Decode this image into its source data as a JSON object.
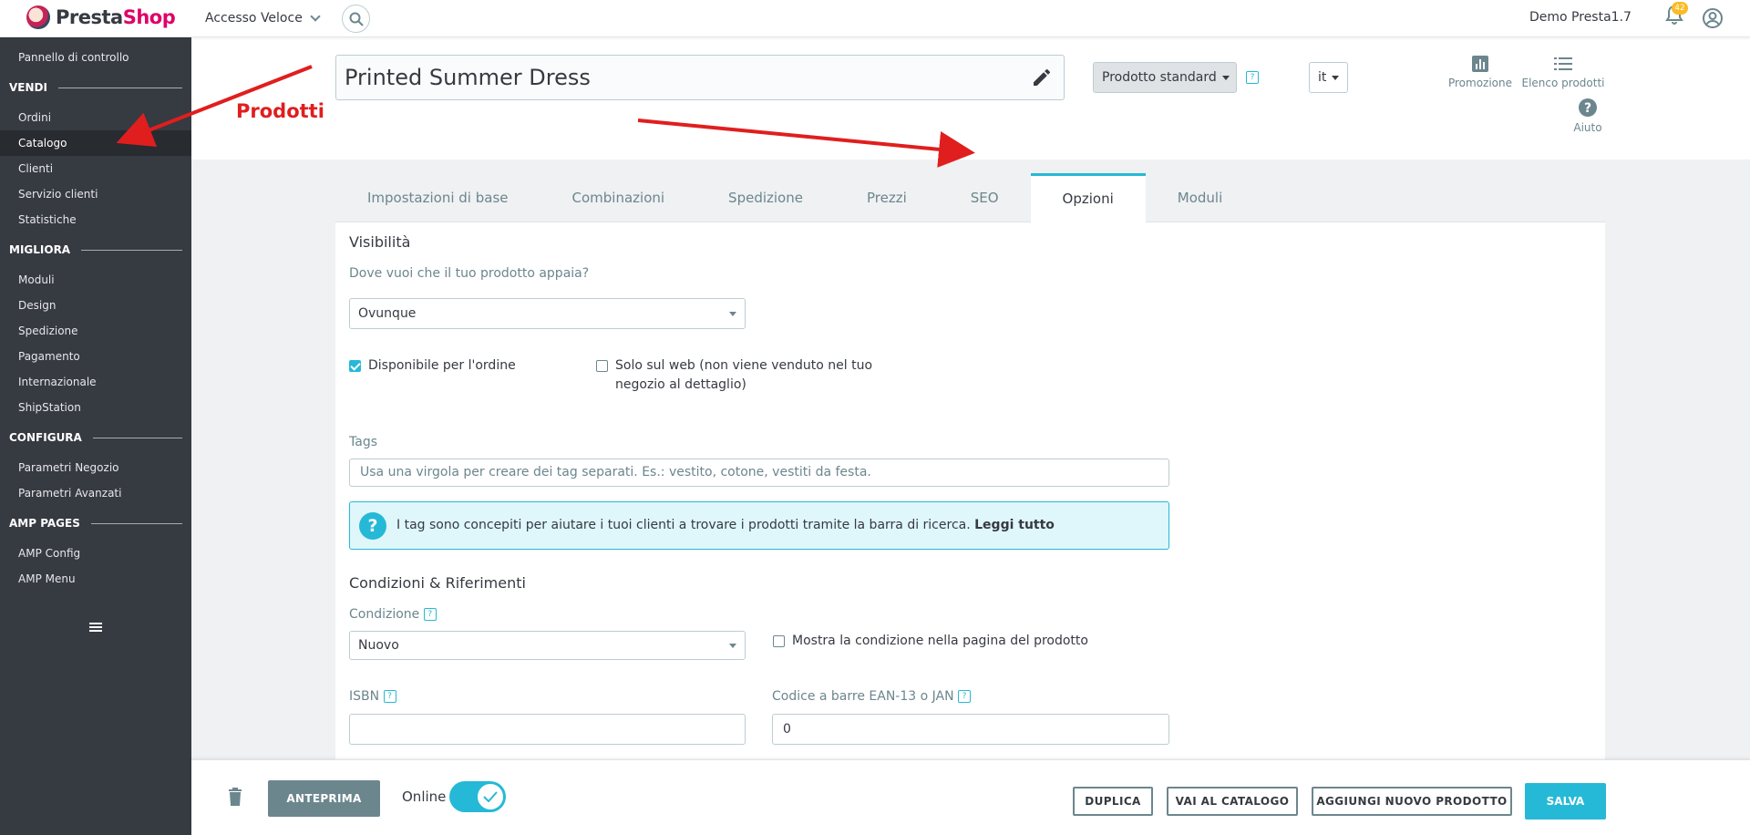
{
  "header": {
    "logo_pre": "Presta",
    "logo_post": "Shop",
    "quick_access": "Accesso Veloce",
    "user_name": "Demo Presta1.7",
    "notifications_count": "42"
  },
  "sidebar": {
    "dashboard": "Pannello di controllo",
    "sections": [
      {
        "title": "VENDI",
        "items": [
          "Ordini",
          "Catalogo",
          "Clienti",
          "Servizio clienti",
          "Statistiche"
        ]
      },
      {
        "title": "MIGLIORA",
        "items": [
          "Moduli",
          "Design",
          "Spedizione",
          "Pagamento",
          "Internazionale",
          "ShipStation"
        ]
      },
      {
        "title": "CONFIGURA",
        "items": [
          "Parametri Negozio",
          "Parametri Avanzati"
        ]
      },
      {
        "title": "AMP PAGES",
        "items": [
          "AMP Config",
          "AMP Menu"
        ]
      }
    ]
  },
  "product": {
    "name": "Printed Summer Dress",
    "type": "Prodotto standard",
    "language": "it"
  },
  "toolbar": {
    "promo": "Promozione",
    "list": "Elenco prodotti",
    "help": "Aiuto"
  },
  "annotation": {
    "label": "Prodotti"
  },
  "tabs": [
    "Impostazioni di base",
    "Combinazioni",
    "Spedizione",
    "Prezzi",
    "SEO",
    "Opzioni",
    "Moduli"
  ],
  "visibility": {
    "title": "Visibilità",
    "question": "Dove vuoi che il tuo prodotto appaia?",
    "selected": "Ovunque",
    "available_label": "Disponibile per l'ordine",
    "web_only_line1": "Solo sul web (non viene venduto nel tuo",
    "web_only_line2": "negozio al dettaglio)"
  },
  "tags": {
    "label": "Tags",
    "placeholder": "Usa una virgola per creare dei tag separati. Es.: vestito, cotone, vestiti da festa.",
    "info_text": "I tag sono concepiti per aiutare i tuoi clienti a trovare i prodotti tramite la barra di ricerca. ",
    "info_link": "Leggi tutto"
  },
  "conditions": {
    "title": "Condizioni & Riferimenti",
    "condition_label": "Condizione",
    "condition_value": "Nuovo",
    "show_condition_label": "Mostra la condizione nella pagina del prodotto",
    "isbn_label": "ISBN",
    "isbn_value": "",
    "ean_label": "Codice a barre EAN-13 o JAN",
    "ean_value": "0"
  },
  "footer": {
    "preview": "ANTEPRIMA",
    "online": "Online",
    "duplicate": "DUPLICA",
    "catalog": "VAI AL CATALOGO",
    "add_new": "AGGIUNGI NUOVO PRODOTTO",
    "save": "SALVA"
  },
  "colors": {
    "accent": "#25b9d7",
    "sidebar_bg": "#363a41",
    "annotation": "#e01e1e"
  }
}
